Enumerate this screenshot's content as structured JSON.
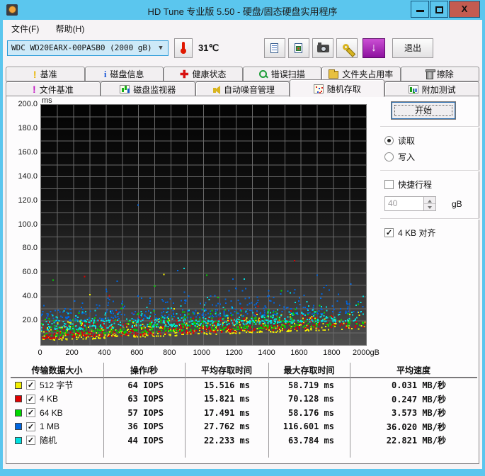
{
  "window": {
    "title": "HD Tune 专业版 5.50 - 硬盘/固态硬盘实用程序",
    "close_glyph": "X"
  },
  "glyphs": {
    "check": "✓",
    "combo_arrow": "▼",
    "update_arrow": "↓"
  },
  "menu": {
    "items": [
      {
        "label": "文件(F)"
      },
      {
        "label": "帮助(H)"
      }
    ]
  },
  "toolbar": {
    "drive_selector": "WDC WD20EARX-00PASB0 (2000 gB)",
    "temperature": "31℃",
    "exit_label": "退出",
    "icons": {
      "thermometer": "thermometer-icon",
      "copy_text": "copy-text-icon",
      "copy_image": "copy-image-icon",
      "screenshot": "camera-icon",
      "options": "wrench-icon",
      "update": "download-arrow-icon"
    }
  },
  "tabs": {
    "row1": [
      {
        "label": "基准",
        "icon": "exclamation-icon"
      },
      {
        "label": "磁盘信息",
        "icon": "info-icon"
      },
      {
        "label": "健康状态",
        "icon": "health-cross-icon"
      },
      {
        "label": "错误扫描",
        "icon": "magnifier-icon"
      },
      {
        "label": "文件夹占用率",
        "icon": "folder-icon"
      },
      {
        "label": "擦除",
        "icon": "trash-icon"
      }
    ],
    "row2": [
      {
        "label": "文件基准",
        "icon": "exclamation-icon"
      },
      {
        "label": "磁盘监视器",
        "icon": "bar-chart-icon"
      },
      {
        "label": "自动噪音管理",
        "icon": "speaker-icon"
      },
      {
        "label": "随机存取",
        "icon": "scatter-icon"
      },
      {
        "label": "附加测试",
        "icon": "chart-icon"
      }
    ],
    "active": "随机存取"
  },
  "panel": {
    "start_label": "开始",
    "read_label": "读取",
    "write_label": "写入",
    "selected_mode": "读取",
    "short_stroke_label": "快捷行程",
    "short_stroke_checked": false,
    "capacity_value": "40",
    "capacity_unit": "gB",
    "align_label": "4 KB 对齐",
    "align_checked": true
  },
  "chart_data": {
    "type": "scatter",
    "title": "随机存取时间散点图",
    "xlabel": "gB",
    "ylabel": "ms",
    "xlim": [
      0,
      2000
    ],
    "ylim": [
      0,
      200
    ],
    "grid": true,
    "x_grid_step": 100,
    "y_grid_step": 10,
    "y_tick_labels": [
      "200.0",
      "180.0",
      "160.0",
      "140.0",
      "120.0",
      "100.0",
      "80.0",
      "60.0",
      "40.0",
      "20.0"
    ],
    "y_tick_values": [
      200,
      180,
      160,
      140,
      120,
      100,
      80,
      60,
      40,
      20
    ],
    "x_tick_labels": [
      "0",
      "200",
      "400",
      "600",
      "800",
      "1000",
      "1200",
      "1400",
      "1600",
      "1800",
      "2000gB"
    ],
    "x_tick_values": [
      0,
      200,
      400,
      600,
      800,
      1000,
      1200,
      1400,
      1600,
      1800,
      2000
    ],
    "series": [
      {
        "name": "512 字节",
        "color": "#f2ee00",
        "iops": 64,
        "avg_ms": 15.516,
        "max_ms": 58.719,
        "speed_mb_s": 0.031,
        "scatter": {
          "n": 430,
          "trend": [
            3,
            13
          ],
          "y_offset": 0.5,
          "y_spread": 17,
          "outliers": [
            [
              755,
              58.7
            ],
            [
              300,
              42
            ]
          ]
        }
      },
      {
        "name": "4 KB",
        "color": "#e00000",
        "iops": 63,
        "avg_ms": 15.821,
        "max_ms": 70.128,
        "speed_mb_s": 0.247,
        "scatter": {
          "n": 420,
          "trend": [
            4,
            14
          ],
          "y_offset": 1,
          "y_spread": 16,
          "outliers": [
            [
              268,
              57
            ],
            [
              1560,
              70.1
            ],
            [
              420,
              41
            ]
          ]
        }
      },
      {
        "name": "64 KB",
        "color": "#00d800",
        "iops": 57,
        "avg_ms": 17.491,
        "max_ms": 58.176,
        "speed_mb_s": 3.573,
        "scatter": {
          "n": 400,
          "trend": [
            5,
            14
          ],
          "y_offset": 2.5,
          "y_spread": 19,
          "outliers": [
            [
              75,
              54
            ],
            [
              1020,
              58.2
            ],
            [
              700,
              49
            ],
            [
              1480,
              45
            ]
          ]
        }
      },
      {
        "name": "1 MB",
        "color": "#0066e0",
        "iops": 36,
        "avg_ms": 27.762,
        "max_ms": 116.601,
        "speed_mb_s": 36.02,
        "scatter": {
          "n": 360,
          "trend": [
            6,
            14
          ],
          "y_offset": 13,
          "y_spread": 26,
          "outliers": [
            [
              598,
              116.6
            ],
            [
              840,
              62
            ],
            [
              1700,
              58
            ],
            [
              1180,
              55
            ]
          ]
        }
      },
      {
        "name": "随机",
        "color": "#00e0e0",
        "iops": 44,
        "avg_ms": 22.233,
        "max_ms": 63.784,
        "speed_mb_s": 22.821,
        "scatter": {
          "n": 380,
          "trend": [
            5,
            13
          ],
          "y_offset": 7,
          "y_spread": 20,
          "band_y": 20,
          "band_n": 80,
          "outliers": [
            [
              880,
              63.8
            ],
            [
              1250,
              55
            ]
          ]
        }
      }
    ]
  },
  "table": {
    "headers": [
      "传输数据大小",
      "操作/秒",
      "平均存取时间",
      "最大存取时间",
      "平均速度"
    ],
    "rows": [
      {
        "color": "#f2ee00",
        "label": "512 字节",
        "checked": true,
        "iops": "64 IOPS",
        "avg": "15.516 ms",
        "max": "58.719 ms",
        "speed": "0.031 MB/秒"
      },
      {
        "color": "#e00000",
        "label": "4 KB",
        "checked": true,
        "iops": "63 IOPS",
        "avg": "15.821 ms",
        "max": "70.128 ms",
        "speed": "0.247 MB/秒"
      },
      {
        "color": "#00d800",
        "label": "64 KB",
        "checked": true,
        "iops": "57 IOPS",
        "avg": "17.491 ms",
        "max": "58.176 ms",
        "speed": "3.573 MB/秒"
      },
      {
        "color": "#0066e0",
        "label": "1 MB",
        "checked": true,
        "iops": "36 IOPS",
        "avg": "27.762 ms",
        "max": "116.601 ms",
        "speed": "36.020 MB/秒"
      },
      {
        "color": "#00e0e0",
        "label": "随机",
        "checked": true,
        "iops": "44 IOPS",
        "avg": "22.233 ms",
        "max": "63.784 ms",
        "speed": "22.821 MB/秒"
      }
    ]
  }
}
